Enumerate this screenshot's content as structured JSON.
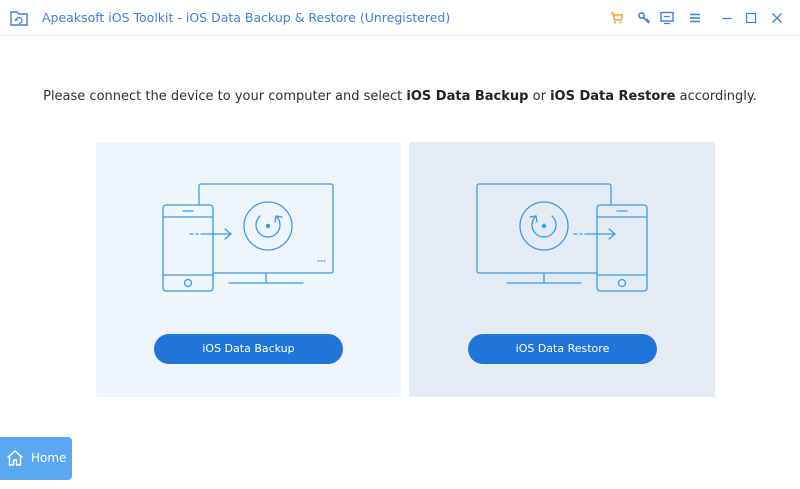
{
  "window": {
    "title": "Apeaksoft iOS Toolkit - iOS Data Backup & Restore (Unregistered)",
    "icons": [
      "app-folder-icon",
      "cart-icon",
      "key-icon",
      "feedback-icon",
      "menu-icon",
      "minimize-icon",
      "maximize-icon",
      "close-icon"
    ]
  },
  "instruction": {
    "prefix": "Please connect the device to your computer and select ",
    "backup_bold": "iOS Data Backup",
    "middle": " or ",
    "restore_bold": "iOS Data Restore",
    "suffix": " accordingly."
  },
  "cards": {
    "backup": {
      "button_label": "iOS Data Backup",
      "illustration": "phone-to-computer-sync-icon"
    },
    "restore": {
      "button_label": "iOS Data Restore",
      "illustration": "computer-to-phone-restore-icon"
    }
  },
  "home": {
    "label": "Home",
    "icon": "home-icon"
  },
  "colors": {
    "title": "#3f7fd6",
    "cart_icon": "#f5a623",
    "window_icons": "#3f7fd6",
    "backup_panel_bg": "#eef5fd",
    "restore_panel_bg": "#e4ebf4",
    "button_bg": "#2175d9",
    "home_bg": "#5aa8f2",
    "illustration_stroke": "#3a9be8"
  }
}
